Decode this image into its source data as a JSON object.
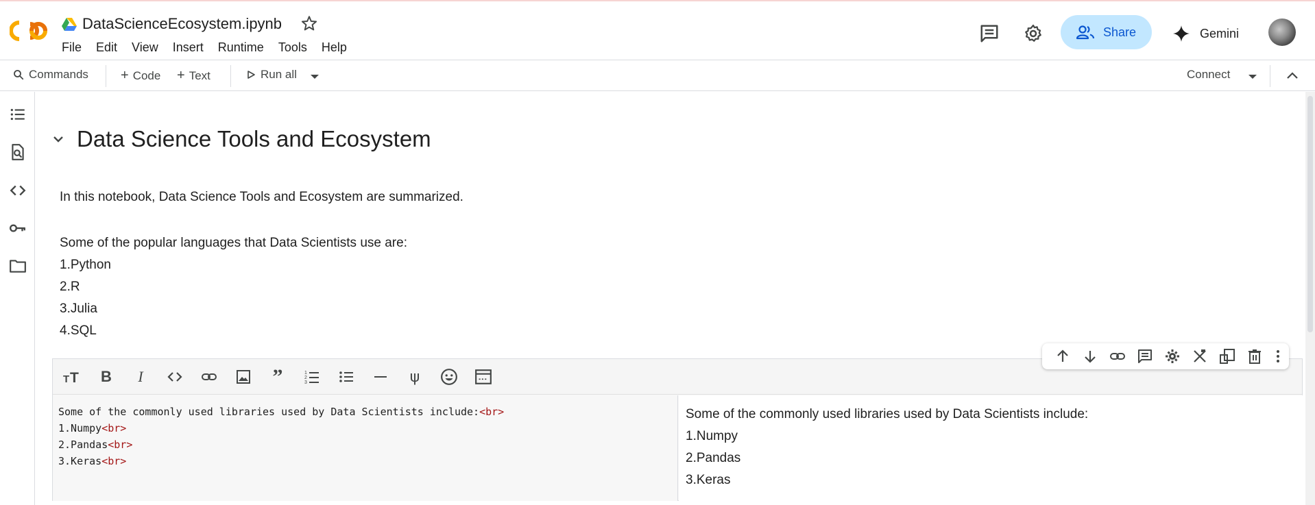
{
  "header": {
    "notebook_title": "DataScienceEcosystem.ipynb",
    "menu": [
      "File",
      "Edit",
      "View",
      "Insert",
      "Runtime",
      "Tools",
      "Help"
    ],
    "share_label": "Share",
    "gemini_label": "Gemini"
  },
  "toolbar": {
    "commands_label": "Commands",
    "code_label": "Code",
    "text_label": "Text",
    "run_all_label": "Run all",
    "connect_label": "Connect"
  },
  "notebook": {
    "section_title": "Data Science Tools and Ecosystem",
    "intro": "In this notebook, Data Science Tools and Ecosystem are summarized.",
    "languages_heading": "Some of the popular languages that Data Scientists use are:",
    "languages": [
      "1.Python",
      "2.R",
      "3.Julia",
      "4.SQL"
    ]
  },
  "editing_cell": {
    "source_lines": [
      {
        "text": "Some of the commonly used libraries used by Data Scientists include:",
        "tag": "<br>"
      },
      {
        "text": "1.Numpy",
        "tag": "<br>"
      },
      {
        "text": "2.Pandas",
        "tag": "<br>"
      },
      {
        "text": "3.Keras",
        "tag": "<br>"
      }
    ],
    "preview_heading": "Some of the commonly used libraries used by Data Scientists include:",
    "preview_items": [
      "1.Numpy",
      "2.Pandas",
      "3.Keras"
    ]
  },
  "colors": {
    "share_bg": "#c2e7ff",
    "share_text": "#0b57d0",
    "logo_orange": "#f9ab00",
    "logo_dark_orange": "#e8710a",
    "html_tag": "#a31515"
  },
  "icons": {
    "left_sidebar": [
      "table-of-contents-icon",
      "find-icon",
      "code-snippets-icon",
      "secrets-key-icon",
      "files-folder-icon"
    ],
    "format_bar": [
      "text-size-icon",
      "bold-icon",
      "italic-icon",
      "code-icon",
      "link-icon",
      "image-icon",
      "quote-icon",
      "numbered-list-icon",
      "bullet-list-icon",
      "horizontal-rule-icon",
      "psi-icon",
      "emoji-icon",
      "preview-panel-icon"
    ],
    "cell_tools": [
      "move-up-icon",
      "move-down-icon",
      "link-icon",
      "comment-icon",
      "settings-icon",
      "close-editor-icon",
      "mirror-cell-icon",
      "delete-icon",
      "more-vert-icon"
    ]
  }
}
